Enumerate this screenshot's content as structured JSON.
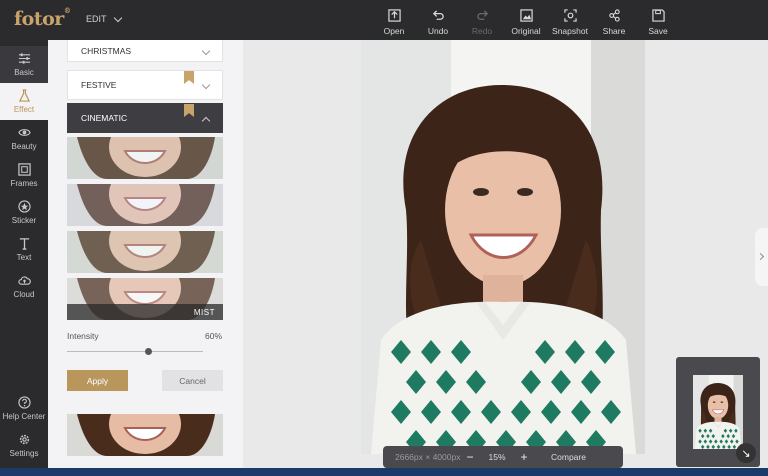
{
  "header": {
    "logo": "fotor",
    "logo_mark": "®",
    "edit_label": "EDIT",
    "tools": [
      {
        "label": "Open",
        "icon": "open-icon",
        "enabled": true
      },
      {
        "label": "Undo",
        "icon": "undo-icon",
        "enabled": true
      },
      {
        "label": "Redo",
        "icon": "redo-icon",
        "enabled": false
      },
      {
        "label": "Original",
        "icon": "original-icon",
        "enabled": true
      },
      {
        "label": "Snapshot",
        "icon": "snapshot-icon",
        "enabled": true
      },
      {
        "label": "Share",
        "icon": "share-icon",
        "enabled": true
      },
      {
        "label": "Save",
        "icon": "save-icon",
        "enabled": true
      }
    ]
  },
  "sidebar": {
    "items": [
      {
        "label": "Basic",
        "icon": "sliders-icon"
      },
      {
        "label": "Effect",
        "icon": "flask-icon",
        "active": true
      },
      {
        "label": "Beauty",
        "icon": "eye-icon"
      },
      {
        "label": "Frames",
        "icon": "frame-icon"
      },
      {
        "label": "Sticker",
        "icon": "sticker-icon"
      },
      {
        "label": "Text",
        "icon": "text-icon"
      },
      {
        "label": "Cloud",
        "icon": "cloud-icon"
      }
    ],
    "bottom_items": [
      {
        "label": "Help Center",
        "icon": "help-icon"
      },
      {
        "label": "Settings",
        "icon": "gear-icon"
      }
    ]
  },
  "panel": {
    "categories": [
      {
        "label": "CHRISTMAS"
      },
      {
        "label": "FESTIVE"
      },
      {
        "label": "CINEMATIC"
      }
    ],
    "selected_effect_label": "MIST",
    "intensity_label": "Intensity",
    "intensity_value": "60%",
    "intensity_fraction": 0.6,
    "apply_label": "Apply",
    "cancel_label": "Cancel"
  },
  "canvas": {
    "dimensions": "2666px × 4000px",
    "zoom_out": "−",
    "zoom": "15%",
    "zoom_in": "+",
    "compare_label": "Compare"
  },
  "colors": {
    "accent": "#b8965c",
    "topbar": "#2b2b2e",
    "panel": "#f3f3f5"
  }
}
